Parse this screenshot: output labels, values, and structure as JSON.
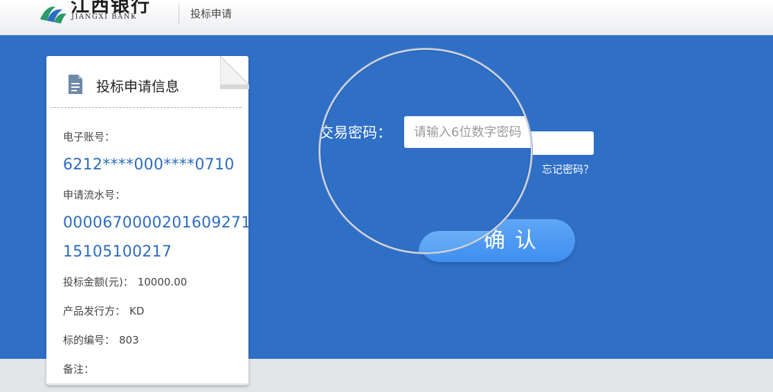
{
  "header": {
    "logo_cn": "江西银行",
    "logo_en": "JIANGXI BANK",
    "title": "投标申请"
  },
  "card": {
    "title": "投标申请信息",
    "account_label": "电子账号：",
    "account_value": "6212****000****0710",
    "serial_label": "申请流水号：",
    "serial_value_line1": "0000670000201609271",
    "serial_value_line2": "15105100217",
    "amount_label": "投标金额(元)：",
    "amount_value": "10000.00",
    "issuer_label": "产品发行方：",
    "issuer_value": "KD",
    "bid_no_label": "标的编号：",
    "bid_no_value": "803",
    "remark_label": "备注："
  },
  "form": {
    "password_label": "交易密码：",
    "password_placeholder": "请输入6位数字密码",
    "forgot_password": "忘记密码？",
    "confirm_label": "确认"
  },
  "colors": {
    "band": "#2f6fc6",
    "value_blue": "#2d6cc0",
    "button": "#4a96f0"
  }
}
